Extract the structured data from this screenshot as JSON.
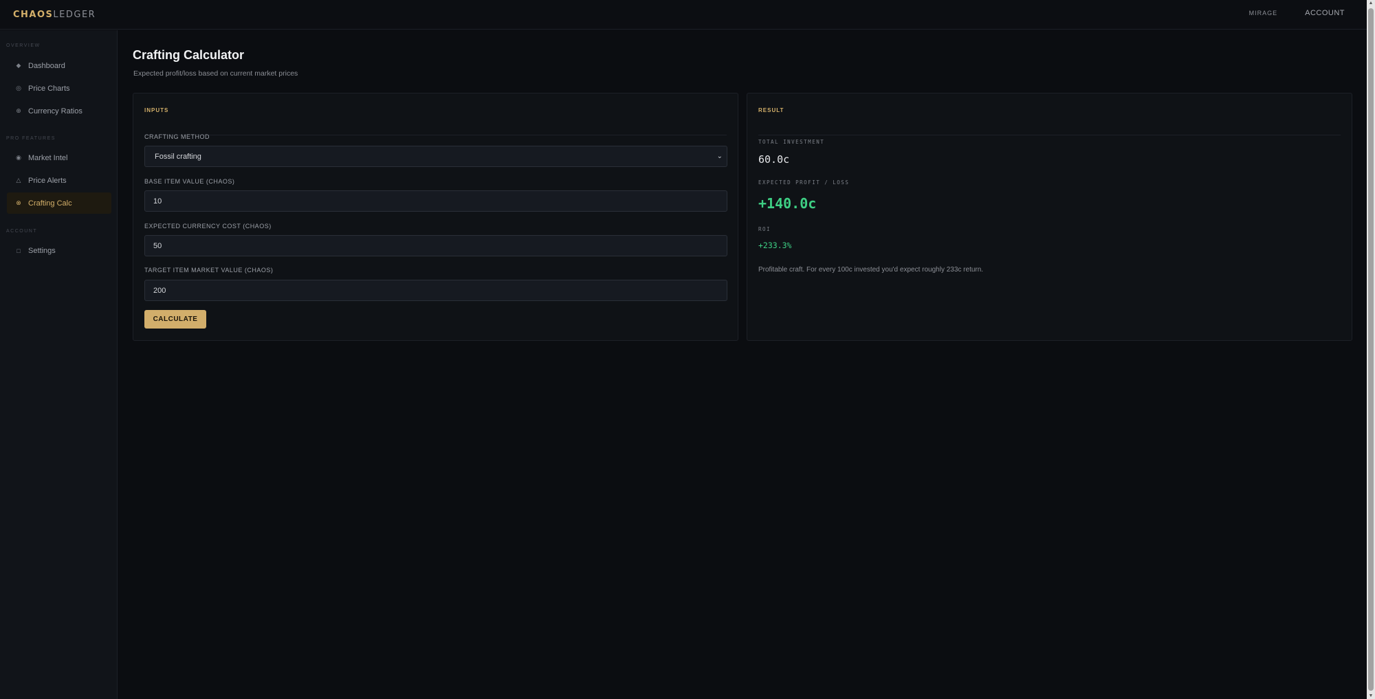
{
  "app": {
    "logo_part1": "CHAOS",
    "logo_part2": "LEDGER",
    "league": "MIRAGE",
    "account": "ACCOUNT"
  },
  "sidebar": {
    "sections": [
      {
        "label": "OVERVIEW",
        "items": [
          {
            "label": "Dashboard",
            "icon": "diamond-icon"
          },
          {
            "label": "Price Charts",
            "icon": "chart-icon"
          },
          {
            "label": "Currency Ratios",
            "icon": "globe-icon"
          }
        ]
      },
      {
        "label": "PRO FEATURES",
        "items": [
          {
            "label": "Market Intel",
            "icon": "target-icon"
          },
          {
            "label": "Price Alerts",
            "icon": "warning-icon"
          },
          {
            "label": "Crafting Calc",
            "icon": "crafting-icon",
            "active": true
          }
        ]
      },
      {
        "label": "ACCOUNT",
        "items": [
          {
            "label": "Settings",
            "icon": "square-icon"
          }
        ]
      }
    ]
  },
  "page": {
    "title": "Crafting Calculator",
    "subtitle": "Expected profit/loss based on current market prices"
  },
  "inputs": {
    "heading": "INPUTS",
    "method_label": "CRAFTING METHOD",
    "method_value": "Fossil crafting",
    "base_label": "BASE ITEM VALUE (CHAOS)",
    "base_value": "10",
    "cost_label": "EXPECTED CURRENCY COST (CHAOS)",
    "cost_value": "50",
    "target_label": "TARGET ITEM MARKET VALUE (CHAOS)",
    "target_value": "200",
    "calculate_label": "CALCULATE"
  },
  "result": {
    "heading": "RESULT",
    "total_label": "TOTAL INVESTMENT",
    "total_value": "60.0c",
    "profit_label": "EXPECTED PROFIT / LOSS",
    "profit_value": "+140.0c",
    "roi_label": "ROI",
    "roi_value": "+233.3%",
    "note": "Profitable craft. For every 100c invested you'd expect roughly 233c return."
  },
  "colors": {
    "accent": "#d4b06a",
    "profit": "#3ecf84",
    "background": "#0b0d11"
  }
}
